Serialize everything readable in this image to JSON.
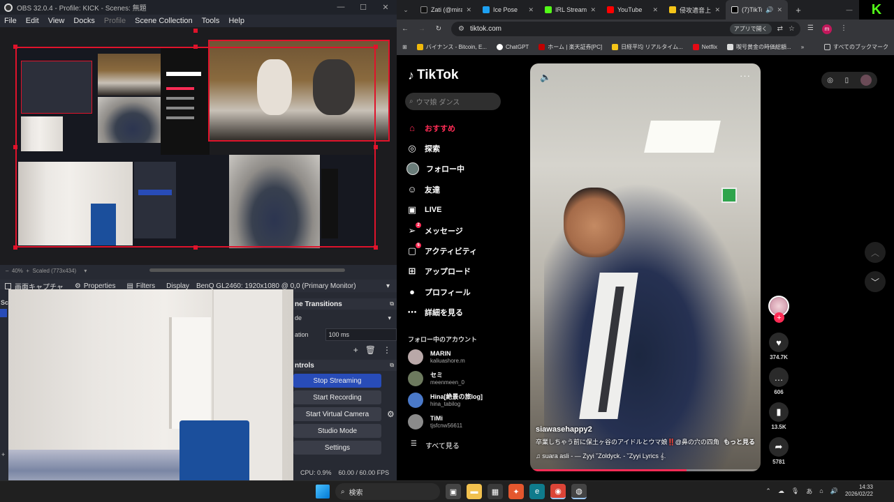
{
  "obs": {
    "title": "OBS 32.0.4 - Profile: KICK - Scenes: 無題",
    "menu": [
      "File",
      "Edit",
      "View",
      "Docks",
      "Profile",
      "Scene Collection",
      "Tools",
      "Help"
    ],
    "zoom": "40%",
    "scaled": "Scaled (773x434)",
    "source_name": "画面キャプチャ",
    "properties_label": "Properties",
    "filters_label": "Filters",
    "display_label": "Display",
    "monitor": "BenQ GL2460: 1920x1080 @ 0,0 (Primary Monitor)",
    "transitions": {
      "title": "ne Transitions",
      "type_label": "de",
      "duration_label": "ation",
      "duration": "100 ms"
    },
    "controls": {
      "title": "ntrols",
      "stop_streaming": "Stop Streaming",
      "start_recording": "Start Recording",
      "start_virtual_camera": "Start Virtual Camera",
      "studio_mode": "Studio Mode",
      "settings": "Settings"
    },
    "status": {
      "cpu": "CPU: 0.9%",
      "fps": "60.00 / 60.00 FPS"
    },
    "left_edge": "Sc"
  },
  "chrome": {
    "tabs": [
      {
        "title": "Zati (@mira",
        "color": "#111111",
        "active": false
      },
      {
        "title": "Ice Pose",
        "color": "#1da1f2",
        "active": false
      },
      {
        "title": "IRL Streami",
        "color": "#53fc18",
        "active": false
      },
      {
        "title": "YouTube",
        "color": "#ff0000",
        "active": false
      },
      {
        "title": "侵攻適音上",
        "color": "#f5c518",
        "active": false
      },
      {
        "title": "(7)TikTo",
        "color": "#ffffff",
        "active": true
      }
    ],
    "url": "tiktok.com",
    "open_in_app": "アプリで開く",
    "avatar_letter": "m",
    "bookmarks": [
      {
        "label": "バイナンス - Bitcoin, E...",
        "color": "#f0b90b"
      },
      {
        "label": "ChatGPT",
        "color": "#ffffff"
      },
      {
        "label": "ホーム | 楽天証券[PC]",
        "color": "#bf0000"
      },
      {
        "label": "日経平均 リアルタイム...",
        "color": "#f5c518"
      },
      {
        "label": "Netflix",
        "color": "#e50914"
      },
      {
        "label": "喫号黄金の時価総額...",
        "color": "#dddddd"
      }
    ],
    "all_bookmarks": "すべてのブックマーク",
    "kick_logo": "K"
  },
  "tiktok": {
    "logo": "TikTok",
    "search_placeholder": "ウマ娘 ダンス",
    "nav": [
      {
        "label": "おすすめ",
        "icon": "home-icon",
        "glyph": "⌂",
        "active": true,
        "badge": ""
      },
      {
        "label": "探索",
        "icon": "compass-icon",
        "glyph": "◎",
        "active": false,
        "badge": ""
      },
      {
        "label": "フォロー中",
        "icon": "following-avatar-icon",
        "glyph": "◉",
        "active": false,
        "badge": ""
      },
      {
        "label": "友達",
        "icon": "friends-icon",
        "glyph": "☺",
        "active": false,
        "badge": ""
      },
      {
        "label": "LIVE",
        "icon": "live-icon",
        "glyph": "▣",
        "active": false,
        "badge": ""
      },
      {
        "label": "メッセージ",
        "icon": "message-icon",
        "glyph": "➢",
        "active": false,
        "badge": "2"
      },
      {
        "label": "アクティビティ",
        "icon": "activity-icon",
        "glyph": "▢",
        "active": false,
        "badge": "5"
      },
      {
        "label": "アップロード",
        "icon": "upload-icon",
        "glyph": "⊞",
        "active": false,
        "badge": ""
      },
      {
        "label": "プロフィール",
        "icon": "profile-icon",
        "glyph": "●",
        "active": false,
        "badge": ""
      },
      {
        "label": "詳細を見る",
        "icon": "more-icon",
        "glyph": "⋯",
        "active": false,
        "badge": ""
      }
    ],
    "following_title": "フォロー中のアカウント",
    "following": [
      {
        "name": "MARIN",
        "handle": "kaliuashore.m",
        "color": "#b9a8a8"
      },
      {
        "name": "セミ",
        "handle": "meenmeen_0",
        "color": "#6d7a5e"
      },
      {
        "name": "Hina[絶景の旅log]",
        "handle": "hina_tabilog",
        "color": "#4a79c9"
      },
      {
        "name": "TiMi",
        "handle": "tjsfcnw56611",
        "color": "#8b8b8b"
      }
    ],
    "see_all": "すべて見る",
    "video": {
      "author": "siawasehappy2",
      "caption": "卒業しちゃう前に保土ヶ谷のアイドルとウマ娘‼️@鼻の穴の四角 #...",
      "more": "もっと見る",
      "music": "♫ suara asli - — Zyyi ˘Zoldyck. - ˘Zyyi Lyrics 𝄞.",
      "progress": 0.68
    },
    "actions": [
      {
        "name": "like",
        "glyph": "♥",
        "count": "374.7K"
      },
      {
        "name": "comment",
        "glyph": "…",
        "count": "606"
      },
      {
        "name": "bookmark",
        "glyph": "▮",
        "count": "13.5K"
      },
      {
        "name": "share",
        "glyph": "➦",
        "count": "5781"
      }
    ]
  },
  "taskbar": {
    "search_label": "検索",
    "time": "14:33",
    "date": "2026/02/22",
    "ime": "あ"
  }
}
